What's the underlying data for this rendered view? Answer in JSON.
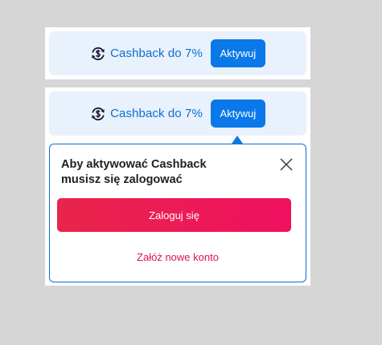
{
  "cashback_widget_top": {
    "label": "Cashback do 7%",
    "button_label": "Aktywuj",
    "icon": "cashback-cycle-icon"
  },
  "cashback_widget_bottom": {
    "label": "Cashback do 7%",
    "button_label": "Aktywuj",
    "icon": "cashback-cycle-icon"
  },
  "login_popover": {
    "title_line1": "Aby aktywować Cashback",
    "title_line2": "musisz się zalogować",
    "login_button_label": "Zaloguj się",
    "register_link_label": "Załóż nowe konto",
    "close_icon": "close-icon"
  },
  "colors": {
    "primary_blue": "#0a78e8",
    "bar_background": "#e8f1fc",
    "accent_pink": "#e8254a",
    "link_pink": "#d9134f"
  }
}
